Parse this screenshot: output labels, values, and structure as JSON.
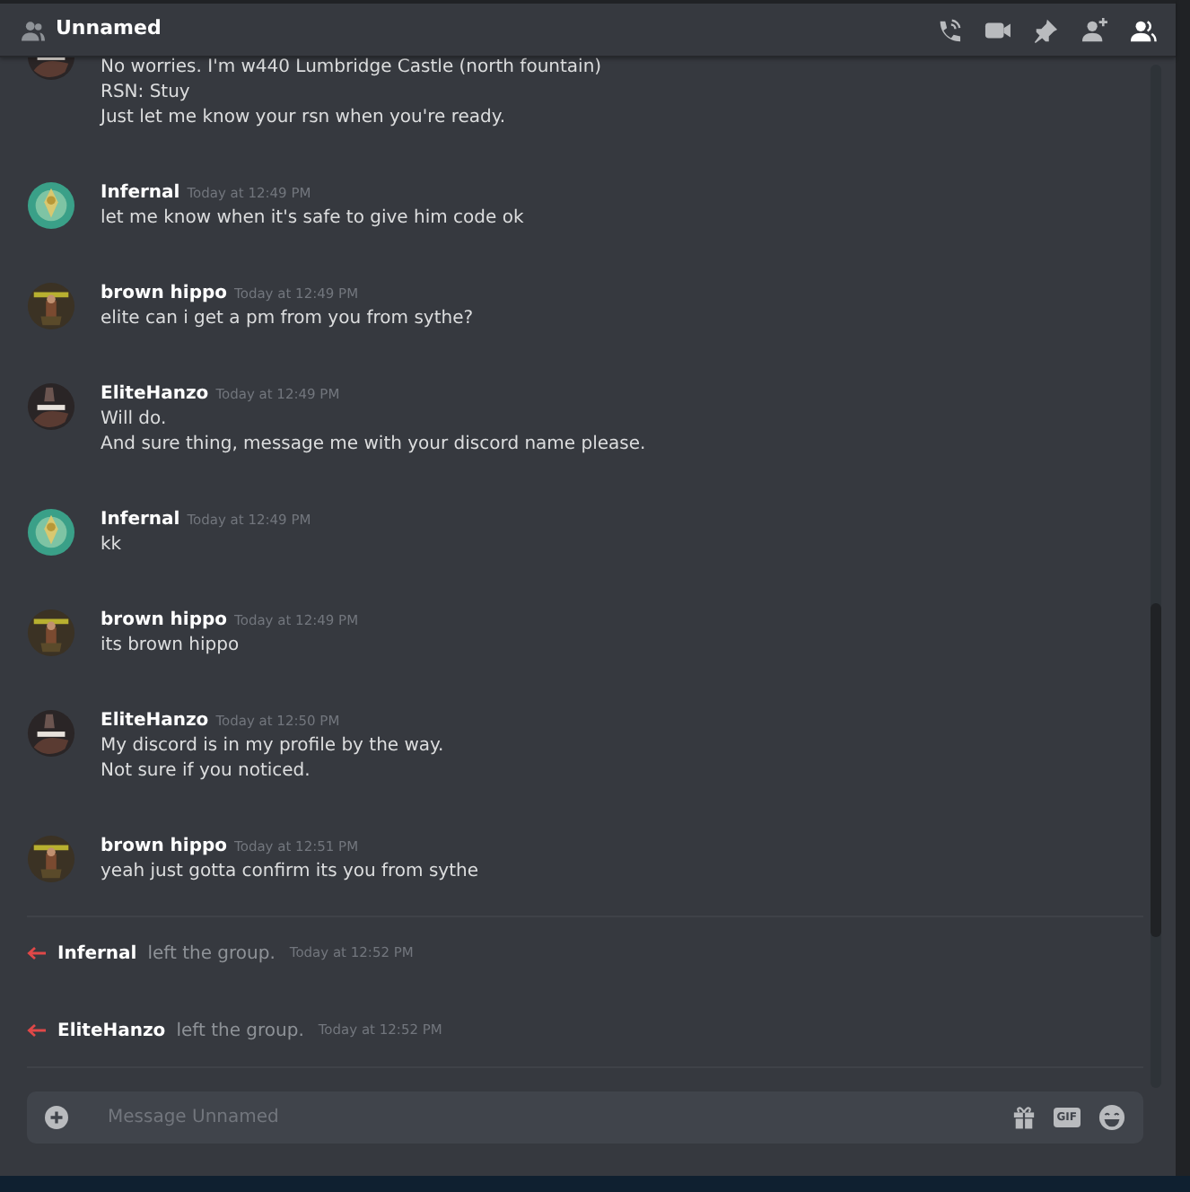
{
  "header": {
    "title": "Unnamed",
    "icons": [
      {
        "kind": "call",
        "active": false
      },
      {
        "kind": "video",
        "active": false
      },
      {
        "kind": "pin",
        "active": false
      },
      {
        "kind": "add-friend",
        "active": false
      },
      {
        "kind": "members",
        "active": true
      }
    ]
  },
  "messages": [
    {
      "kind": "hanzo",
      "lines": [
        "No worries. I'm w440 Lumbridge Castle (north fountain)",
        "RSN: Stuy",
        "Just let me know your rsn when you're ready."
      ]
    },
    {
      "kind": "infernal",
      "author": "Infernal",
      "time": "Today at 12:49 PM",
      "lines": [
        "let me know when it's safe to give him code ok"
      ]
    },
    {
      "kind": "hippo",
      "author": "brown hippo",
      "time": "Today at 12:49 PM",
      "lines": [
        "elite can i get a pm from you from sythe?"
      ]
    },
    {
      "kind": "hanzo",
      "author": "EliteHanzo",
      "time": "Today at 12:49 PM",
      "lines": [
        "Will do.",
        "And sure thing, message me with your discord name please."
      ]
    },
    {
      "kind": "infernal",
      "author": "Infernal",
      "time": "Today at 12:49 PM",
      "lines": [
        "kk"
      ]
    },
    {
      "kind": "hippo",
      "author": "brown hippo",
      "time": "Today at 12:49 PM",
      "lines": [
        "its brown hippo"
      ]
    },
    {
      "kind": "hanzo",
      "author": "EliteHanzo",
      "time": "Today at 12:50 PM",
      "lines": [
        "My discord is in my profile by the way.",
        "Not sure if you noticed."
      ]
    },
    {
      "kind": "hippo",
      "author": "brown hippo",
      "time": "Today at 12:51 PM",
      "lines": [
        "yeah just gotta confirm its you from sythe"
      ]
    }
  ],
  "events": [
    {
      "user": "Infernal",
      "text": "left the group.",
      "time": "Today at 12:52 PM"
    },
    {
      "user": "EliteHanzo",
      "text": "left the group.",
      "time": "Today at 12:52 PM"
    }
  ],
  "composer": {
    "placeholder": "Message Unnamed",
    "gif_label": "GIF"
  }
}
